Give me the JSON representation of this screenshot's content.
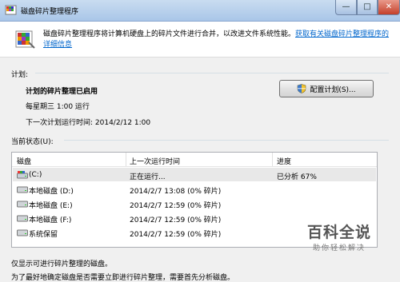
{
  "window": {
    "title": "磁盘碎片整理程序"
  },
  "intro": {
    "text": "磁盘碎片整理程序将计算机硬盘上的碎片文件进行合并，以改进文件系统性能。",
    "link": "获取有关磁盘碎片整理程序的详细信息"
  },
  "schedule": {
    "section_label": "计划:",
    "status": "计划的碎片整理已启用",
    "frequency": "每星期三  1:00 运行",
    "next_run": "下一次计划运行时间: 2014/2/12 1:00",
    "configure_button": "配置计划(S)..."
  },
  "current_status": {
    "section_label": "当前状态(U):",
    "columns": [
      "磁盘",
      "上一次运行时间",
      "进度"
    ],
    "rows": [
      {
        "disk": "(C:)",
        "last_run": "正在运行...",
        "progress": "已分析 67%"
      },
      {
        "disk": "本地磁盘 (D:)",
        "last_run": "2014/2/7 13:08 (0% 碎片)",
        "progress": ""
      },
      {
        "disk": "本地磁盘 (E:)",
        "last_run": "2014/2/7 12:59 (0% 碎片)",
        "progress": ""
      },
      {
        "disk": "本地磁盘 (F:)",
        "last_run": "2014/2/7 12:59 (0% 碎片)",
        "progress": ""
      },
      {
        "disk": "系统保留",
        "last_run": "2014/2/7 12:59 (0% 碎片)",
        "progress": ""
      }
    ]
  },
  "footer": {
    "line1": "仅显示可进行碎片整理的磁盘。",
    "line2": "为了最好地确定磁盘是否需要立即进行碎片整理，需要首先分析磁盘。"
  },
  "watermark": {
    "title": "百科全说",
    "subtitle": "助你轻松解决"
  },
  "colors": {
    "link": "#0066cc",
    "title_gradient_top": "#c9dcf0",
    "close_red": "#c4402a"
  }
}
